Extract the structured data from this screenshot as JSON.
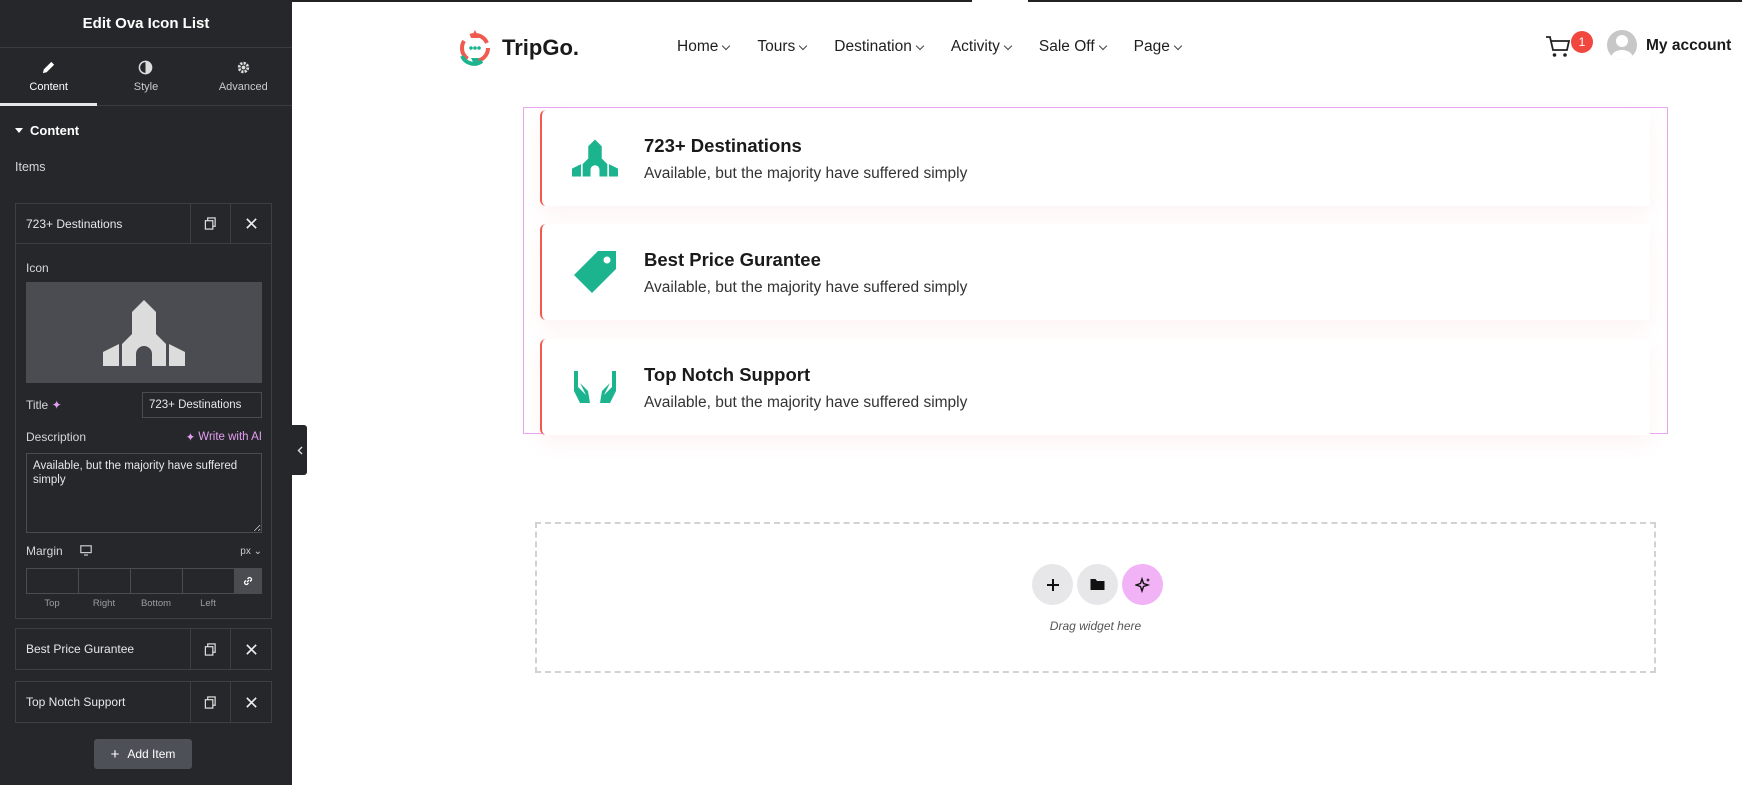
{
  "panel": {
    "title": "Edit Ova Icon List",
    "tabs": [
      {
        "label": "Content",
        "icon": "pencil-icon"
      },
      {
        "label": "Style",
        "icon": "contrast-icon"
      },
      {
        "label": "Advanced",
        "icon": "gear-icon"
      }
    ],
    "section_title": "Content",
    "items_label": "Items",
    "repeater": [
      {
        "title": "723+ Destinations"
      },
      {
        "title": "Best Price Gurantee"
      },
      {
        "title": "Top Notch Support"
      }
    ],
    "editor": {
      "icon_label": "Icon",
      "title_label": "Title",
      "title_value": "723+ Destinations",
      "description_label": "Description",
      "write_ai_label": "Write with AI",
      "description_value": "Available, but the majority have suffered simply",
      "margin_label": "Margin",
      "margin_unit": "px",
      "margin_sides": [
        "Top",
        "Right",
        "Bottom",
        "Left"
      ]
    },
    "add_item_label": "Add Item"
  },
  "site": {
    "brand": "TripGo.",
    "nav": [
      "Home",
      "Tours",
      "Destination",
      "Activity",
      "Sale Off",
      "Page"
    ],
    "cart_count": "1",
    "account_label": "My account"
  },
  "icon_list": [
    {
      "title": "723+ Destinations",
      "description": "Available, but the majority have suffered simply",
      "icon": "building-icon"
    },
    {
      "title": "Best Price Gurantee",
      "description": "Available, but the majority have suffered simply",
      "icon": "price-tag-icon"
    },
    {
      "title": "Top Notch Support",
      "description": "Available, but the majority have suffered simply",
      "icon": "hands-icon"
    }
  ],
  "dropzone": {
    "text": "Drag widget here"
  },
  "colors": {
    "accent_green": "#1cb38f",
    "accent_red": "#f05a4f",
    "panel_bg": "#26272b",
    "ai_pink": "#e49ef0"
  }
}
